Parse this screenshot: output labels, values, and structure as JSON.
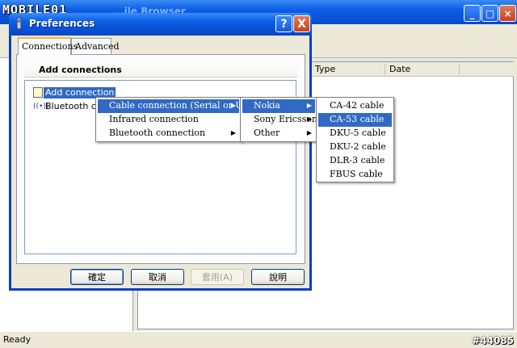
{
  "watermark": {
    "logo": "MOBILE01",
    "image_id": "#44085"
  },
  "main_window": {
    "title": "...ile Browser",
    "list_columns": [
      "Type",
      "Date"
    ],
    "status": "Ready"
  },
  "dialog": {
    "title": "Preferences",
    "tabs": [
      "Connections",
      "Advanced"
    ],
    "section_header": "Add connections",
    "list_items": [
      "Add connection",
      "Bluetooth con"
    ],
    "buttons": {
      "ok": "確定",
      "cancel": "取消",
      "apply": "套用(A)",
      "explain": "說明"
    },
    "help_glyph": "?",
    "close_glyph": "X"
  },
  "context_menu": {
    "level1": [
      "Cable connection (Serial or USB)",
      "Infrared connection",
      "Bluetooth connection"
    ],
    "level2": [
      "Nokia",
      "Sony Ericsson",
      "Other"
    ],
    "level3": [
      "CA-42 cable",
      "CA-53 cable",
      "DKU-5 cable",
      "DKU-2 cable",
      "DLR-3 cable",
      "FBUS cable"
    ],
    "selected_level3": "CA-53 cable"
  },
  "icons": [
    "app-icon",
    "help-icon",
    "close-icon",
    "minimize-icon",
    "maximize-icon",
    "add-connection-icon",
    "bluetooth-icon",
    "submenu-arrow-icon"
  ]
}
